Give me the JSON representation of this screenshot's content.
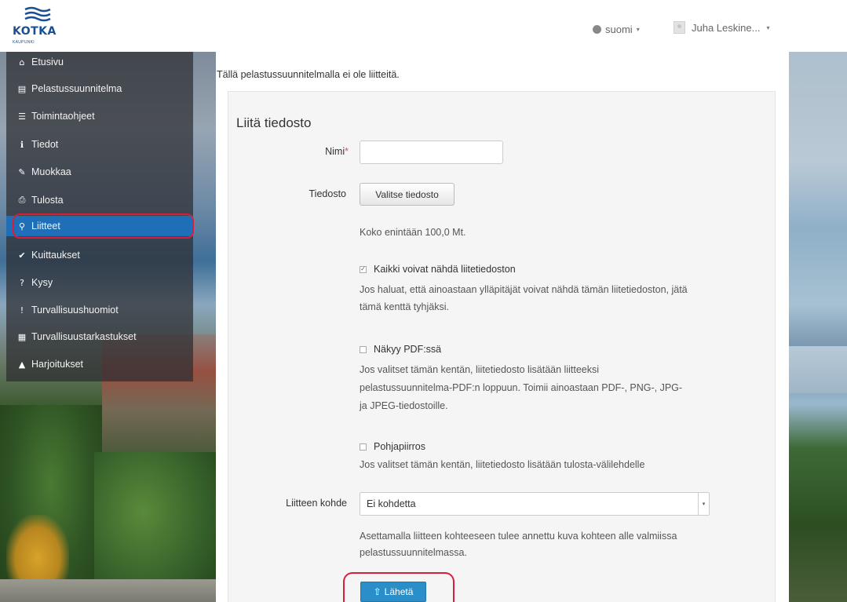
{
  "header": {
    "logo_text": "KOTKA",
    "logo_sub": "KAUPUNKI",
    "language": "suomi",
    "user_name": "Juha Leskine..."
  },
  "sidebar": {
    "items": [
      {
        "label": "Etusivu",
        "icon": "home-icon",
        "glyph": "⌂"
      },
      {
        "label": "Pelastussuunnitelma",
        "icon": "document-icon",
        "glyph": "▤"
      },
      {
        "label": "Toimintaohjeet",
        "icon": "list-icon",
        "glyph": "☰"
      },
      {
        "label": "Tiedot",
        "icon": "info-icon",
        "glyph": "ℹ"
      },
      {
        "label": "Muokkaa",
        "icon": "pencil-icon",
        "glyph": "✎"
      },
      {
        "label": "Tulosta",
        "icon": "print-icon",
        "glyph": "⎙"
      },
      {
        "label": "Liitteet",
        "icon": "paperclip-icon",
        "glyph": "⚲"
      },
      {
        "label": "Kuittaukset",
        "icon": "check-icon",
        "glyph": "✔"
      },
      {
        "label": "Kysy",
        "icon": "question-icon",
        "glyph": "?"
      },
      {
        "label": "Turvallisuushuomiot",
        "icon": "alert-icon",
        "glyph": "!"
      },
      {
        "label": "Turvallisuustarkastukset",
        "icon": "table-icon",
        "glyph": "▦"
      },
      {
        "label": "Harjoitukset",
        "icon": "warning-icon",
        "glyph": "▲"
      }
    ],
    "active_index": 6
  },
  "main": {
    "notice": "Tällä pelastussuunnitelmalla ei ole liitteitä.",
    "form": {
      "title": "Liitä tiedosto",
      "name_label": "Nimi",
      "required_mark": "*",
      "name_value": "",
      "file_label": "Tiedosto",
      "file_button": "Valitse tiedosto",
      "file_help": "Koko enintään 100,0 Mt.",
      "visible_label": "Kaikki voivat nähdä liitetiedoston",
      "visible_checked": true,
      "visible_help_1": "Jos haluat, että ainoastaan ylläpitäjät voivat nähdä tämän liitetiedoston, jätä",
      "visible_help_2": "tämä kenttä tyhjäksi.",
      "pdf_label": "Näkyy PDF:ssä",
      "pdf_checked": false,
      "pdf_help_1": "Jos valitset tämän kentän, liitetiedosto lisätään liitteeksi",
      "pdf_help_2": "pelastussuunnitelma-PDF:n loppuun. Toimii ainoastaan PDF-, PNG-, JPG-",
      "pdf_help_3": "ja JPEG-tiedostoille.",
      "floorplan_label": "Pohjapiirros",
      "floorplan_checked": false,
      "floorplan_help": "Jos valitset tämän kentän, liitetiedosto lisätään tulosta-välilehdelle",
      "target_label": "Liitteen kohde",
      "target_value": "Ei kohdetta",
      "target_help_1": "Asettamalla liitteen kohteeseen tulee annettu kuva kohteen alle valmiissa",
      "target_help_2": "pelastussuunnitelmassa.",
      "submit_label": "Lähetä"
    }
  },
  "colors": {
    "active_nav": "#1e6fb7",
    "highlight_ring": "#d81e38",
    "submit": "#2a8fc9",
    "brand": "#1b4f93"
  }
}
